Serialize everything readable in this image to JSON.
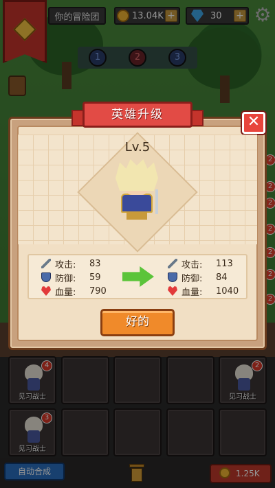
{
  "header": {
    "team_name": "你的冒险团",
    "gold": "13.04K",
    "gems": "30",
    "plus": "+"
  },
  "stages": [
    "1",
    "2",
    "3"
  ],
  "dialog": {
    "title": "英雄升级",
    "close": "✕",
    "level": "Lv.5",
    "before": {
      "attack_label": "攻击:",
      "attack": "83",
      "defense_label": "防御:",
      "defense": "59",
      "hp_label": "血量:",
      "hp": "790"
    },
    "after": {
      "attack_label": "攻击:",
      "attack": "113",
      "defense_label": "防御:",
      "defense": "84",
      "hp_label": "血量:",
      "hp": "1040"
    },
    "ok_label": "好的"
  },
  "grid": {
    "cells": [
      {
        "name": "见习战士",
        "level": "4"
      },
      {
        "name": "",
        "level": ""
      },
      {
        "name": "",
        "level": ""
      },
      {
        "name": "",
        "level": ""
      },
      {
        "name": "见习战士",
        "level": "2"
      },
      {
        "name": "见习战士",
        "level": "3"
      },
      {
        "name": "",
        "level": ""
      },
      {
        "name": "",
        "level": ""
      },
      {
        "name": "",
        "level": ""
      },
      {
        "name": "",
        "level": ""
      }
    ]
  },
  "footer": {
    "auto_merge": "自动合成",
    "buy_price": "1.25K"
  },
  "side_badges": [
    "2",
    "2",
    "2",
    "2",
    "2",
    "2",
    "2"
  ]
}
